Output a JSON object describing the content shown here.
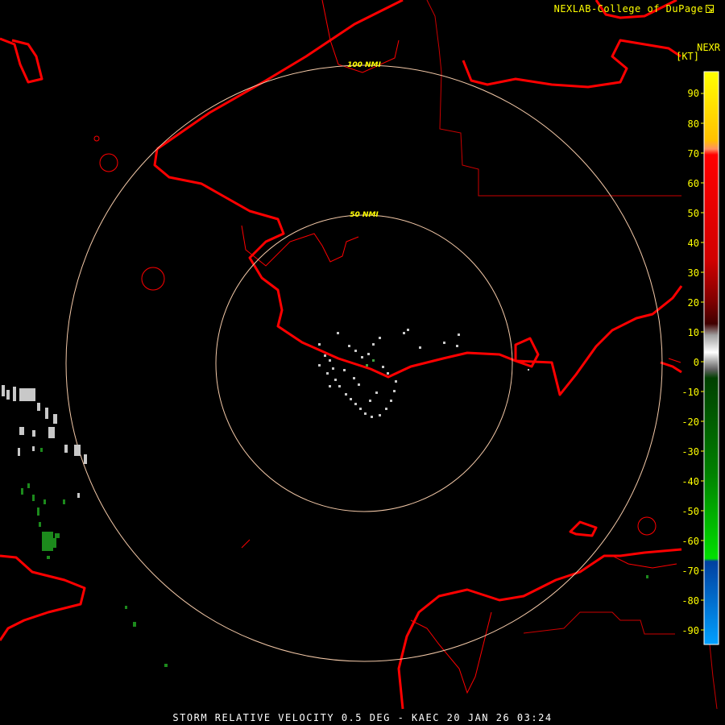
{
  "header": {
    "credit": "NEXLAB-College of DuPage",
    "credit_icon": "external-link-icon"
  },
  "legend": {
    "product": "NEXR",
    "unit": "[KT]",
    "ticks": [
      "90",
      "80",
      "70",
      "60",
      "50",
      "40",
      "30",
      "20",
      "10",
      "0",
      "-10",
      "-20",
      "-30",
      "-40",
      "-50",
      "-60",
      "-70",
      "-80",
      "-90"
    ],
    "colors": {
      "label": "#ffff00"
    }
  },
  "map": {
    "range_rings": [
      "100 NMI",
      "50 NMI"
    ],
    "colors": {
      "background": "#000000",
      "coastline": "#ff0000",
      "borders": "#cc0000",
      "ring": "#f4c9a8",
      "ring_label": "#ffff00"
    }
  },
  "footer": {
    "caption": "STORM RELATIVE VELOCITY 0.5 DEG - KAEC 20 JAN 26 03:24"
  }
}
